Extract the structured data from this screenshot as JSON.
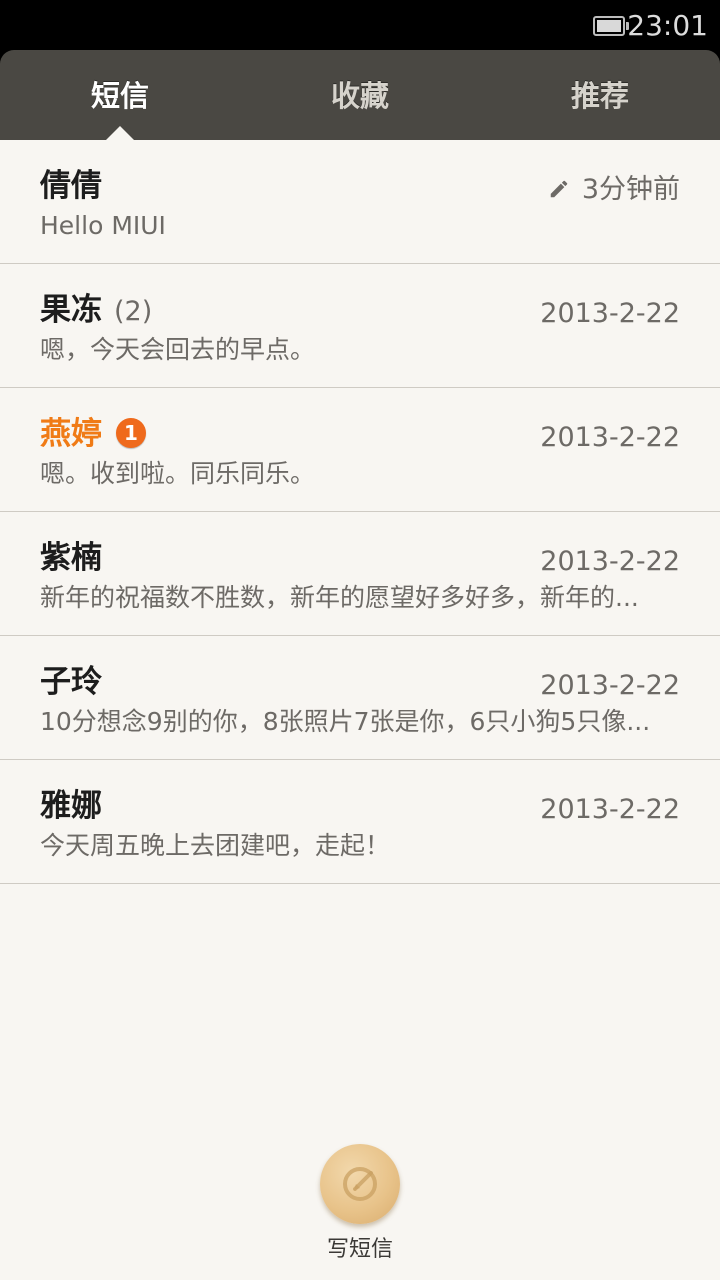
{
  "status_bar": {
    "time": "23:01",
    "battery_icon": "battery-icon"
  },
  "tabs": [
    {
      "label": "短信",
      "active": true
    },
    {
      "label": "收藏",
      "active": false
    },
    {
      "label": "推荐",
      "active": false
    }
  ],
  "threads": [
    {
      "name": "倩倩",
      "count": "",
      "badge": "",
      "time": "3分钟前",
      "draft": true,
      "preview": "Hello MIUI"
    },
    {
      "name": "果冻",
      "count": "(2)",
      "badge": "",
      "time": "2013-2-22",
      "draft": false,
      "preview": "嗯，今天会回去的早点。"
    },
    {
      "name": "燕婷",
      "count": "",
      "badge": "1",
      "time": "2013-2-22",
      "draft": false,
      "preview": "嗯。收到啦。同乐同乐。"
    },
    {
      "name": "紫楠",
      "count": "",
      "badge": "",
      "time": "2013-2-22",
      "draft": false,
      "preview": "新年的祝福数不胜数，新年的愿望好多好多，新年的..."
    },
    {
      "name": "子玲",
      "count": "",
      "badge": "",
      "time": "2013-2-22",
      "draft": false,
      "preview": "10分想念9别的你，8张照片7张是你，6只小狗5只像..."
    },
    {
      "name": "雅娜",
      "count": "",
      "badge": "",
      "time": "2013-2-22",
      "draft": false,
      "preview": "今天周五晚上去团建吧，走起！"
    }
  ],
  "compose": {
    "label": "写短信",
    "icon": "compose-icon"
  },
  "colors": {
    "header_bg": "#4a4843",
    "content_bg": "#f8f6f2",
    "unread_name": "#f07b16",
    "badge_bg": "#ef6a1c"
  }
}
